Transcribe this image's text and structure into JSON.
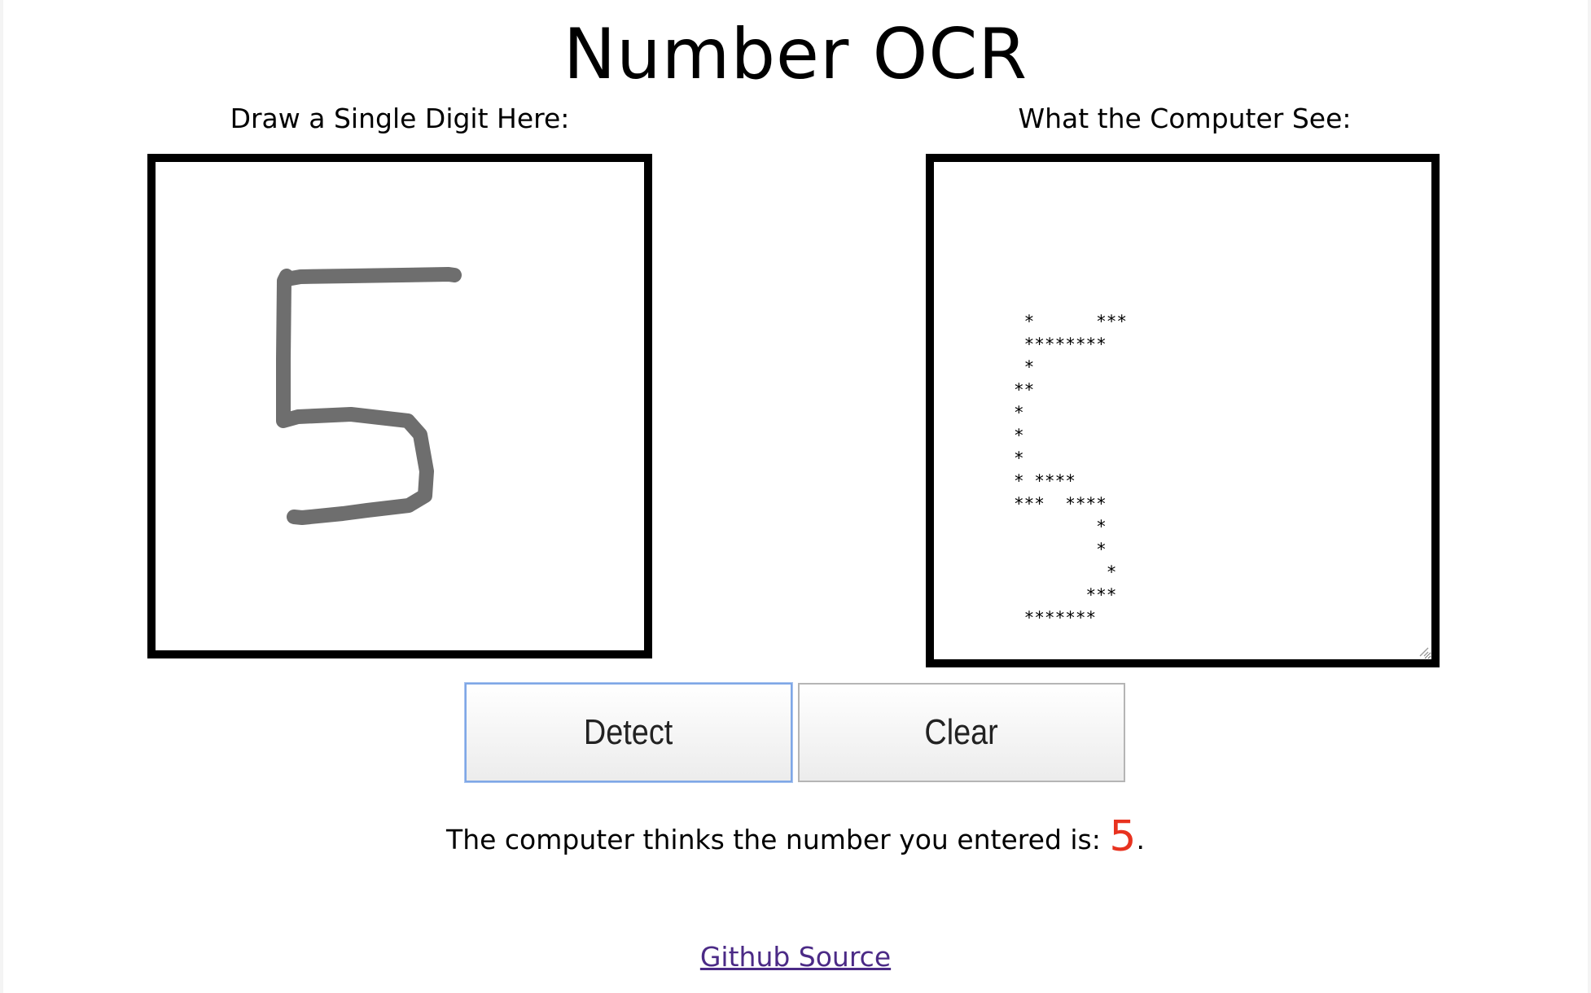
{
  "page": {
    "title": "Number OCR"
  },
  "input_panel": {
    "label": "Draw a Single Digit Here:",
    "drawn_digit": "5",
    "stroke_color": "#6e6e6e"
  },
  "output_panel": {
    "label": "What the Computer See:",
    "ascii_art": " *      ***\n ********\n *\n**\n*\n*\n*\n* ****\n***  ****\n        *\n        *\n         *\n       ***\n *******"
  },
  "buttons": {
    "detect_label": "Detect",
    "clear_label": "Clear"
  },
  "result": {
    "prefix": "The computer thinks the number you entered is: ",
    "number": "5",
    "suffix": ".",
    "number_color": "#e8321f"
  },
  "footer": {
    "link_text": "Github Source"
  }
}
